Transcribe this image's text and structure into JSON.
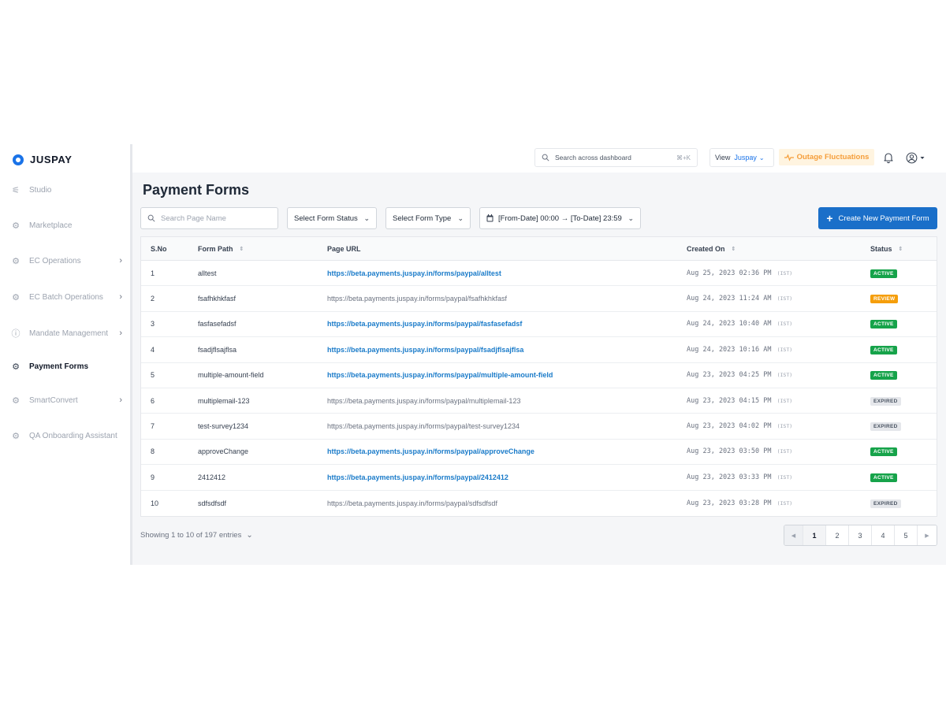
{
  "brand": {
    "name": "JUSPAY",
    "color": "#1a73e8"
  },
  "sidebar": {
    "items": [
      {
        "label": "Studio",
        "icon": "sliders-icon",
        "has_children": false,
        "active": false
      },
      {
        "label": "Marketplace",
        "icon": "marketplace-icon",
        "has_children": false,
        "active": false
      },
      {
        "label": "EC Operations",
        "icon": "settings-gear-icon",
        "has_children": true,
        "active": false
      },
      {
        "label": "EC Batch Operations",
        "icon": "batch-operations-icon",
        "has_children": true,
        "active": false
      },
      {
        "label": "Mandate Management",
        "icon": "mandate-icon",
        "has_children": true,
        "active": false
      },
      {
        "label": "Payment Forms",
        "icon": "payment-forms-icon",
        "has_children": false,
        "active": true
      },
      {
        "label": "SmartConvert",
        "icon": "smart-convert-icon",
        "has_children": true,
        "active": false
      },
      {
        "label": "QA Onboarding Assistant",
        "icon": "qa-assistant-icon",
        "has_children": false,
        "active": false
      }
    ]
  },
  "topbar": {
    "search_placeholder": "Search across dashboard",
    "search_shortcut": "⌘+K",
    "view_label": "View",
    "view_value": "Juspay",
    "outage_label": "Outage Fluctuations"
  },
  "page": {
    "title": "Payment Forms",
    "search_placeholder": "Search Page Name",
    "status_filter": "Select Form Status",
    "type_filter": "Select Form Type",
    "date_range": "[From-Date] 00:00 → [To-Date] 23:59",
    "create_button": "Create New Payment Form"
  },
  "table": {
    "columns": [
      "S.No",
      "Form Path",
      "Page URL",
      "Created On",
      "Status"
    ],
    "rows": [
      {
        "sno": "1",
        "path": "alltest",
        "url": "https://beta.payments.juspay.in/forms/paypal/alltest",
        "created": "Aug 25, 2023 02:36 PM",
        "tz": "(IST)",
        "status": "ACTIVE"
      },
      {
        "sno": "2",
        "path": "fsafhkhkfasf",
        "url": "https://beta.payments.juspay.in/forms/paypal/fsafhkhkfasf",
        "created": "Aug 24, 2023 11:24 AM",
        "tz": "(IST)",
        "status": "REVIEW"
      },
      {
        "sno": "3",
        "path": "fasfasefadsf",
        "url": "https://beta.payments.juspay.in/forms/paypal/fasfasefadsf",
        "created": "Aug 24, 2023 10:40 AM",
        "tz": "(IST)",
        "status": "ACTIVE"
      },
      {
        "sno": "4",
        "path": "fsadjflsajflsa",
        "url": "https://beta.payments.juspay.in/forms/paypal/fsadjflsajflsa",
        "created": "Aug 24, 2023 10:16 AM",
        "tz": "(IST)",
        "status": "ACTIVE"
      },
      {
        "sno": "5",
        "path": "multiple-amount-field",
        "url": "https://beta.payments.juspay.in/forms/paypal/multiple-amount-field",
        "created": "Aug 23, 2023 04:25 PM",
        "tz": "(IST)",
        "status": "ACTIVE"
      },
      {
        "sno": "6",
        "path": "multiplemail-123",
        "url": "https://beta.payments.juspay.in/forms/paypal/multiplemail-123",
        "created": "Aug 23, 2023 04:15 PM",
        "tz": "(IST)",
        "status": "EXPIRED"
      },
      {
        "sno": "7",
        "path": "test-survey1234",
        "url": "https://beta.payments.juspay.in/forms/paypal/test-survey1234",
        "created": "Aug 23, 2023 04:02 PM",
        "tz": "(IST)",
        "status": "EXPIRED"
      },
      {
        "sno": "8",
        "path": "approveChange",
        "url": "https://beta.payments.juspay.in/forms/paypal/approveChange",
        "created": "Aug 23, 2023 03:50 PM",
        "tz": "(IST)",
        "status": "ACTIVE"
      },
      {
        "sno": "9",
        "path": "2412412",
        "url": "https://beta.payments.juspay.in/forms/paypal/2412412",
        "created": "Aug 23, 2023 03:33 PM",
        "tz": "(IST)",
        "status": "ACTIVE"
      },
      {
        "sno": "10",
        "path": "sdfsdfsdf",
        "url": "https://beta.payments.juspay.in/forms/paypal/sdfsdfsdf",
        "created": "Aug 23, 2023 03:28 PM",
        "tz": "(IST)",
        "status": "EXPIRED"
      }
    ]
  },
  "status_colors": {
    "ACTIVE": {
      "bg": "#16a34a",
      "fg": "#ffffff"
    },
    "REVIEW": {
      "bg": "#f59e0b",
      "fg": "#ffffff"
    },
    "EXPIRED": {
      "bg": "#e5e7eb",
      "fg": "#4b5563"
    }
  },
  "footer": {
    "showing": "Showing 1 to 10 of 197 entries",
    "pages": [
      "1",
      "2",
      "3",
      "4",
      "5"
    ],
    "current_page": "1"
  }
}
